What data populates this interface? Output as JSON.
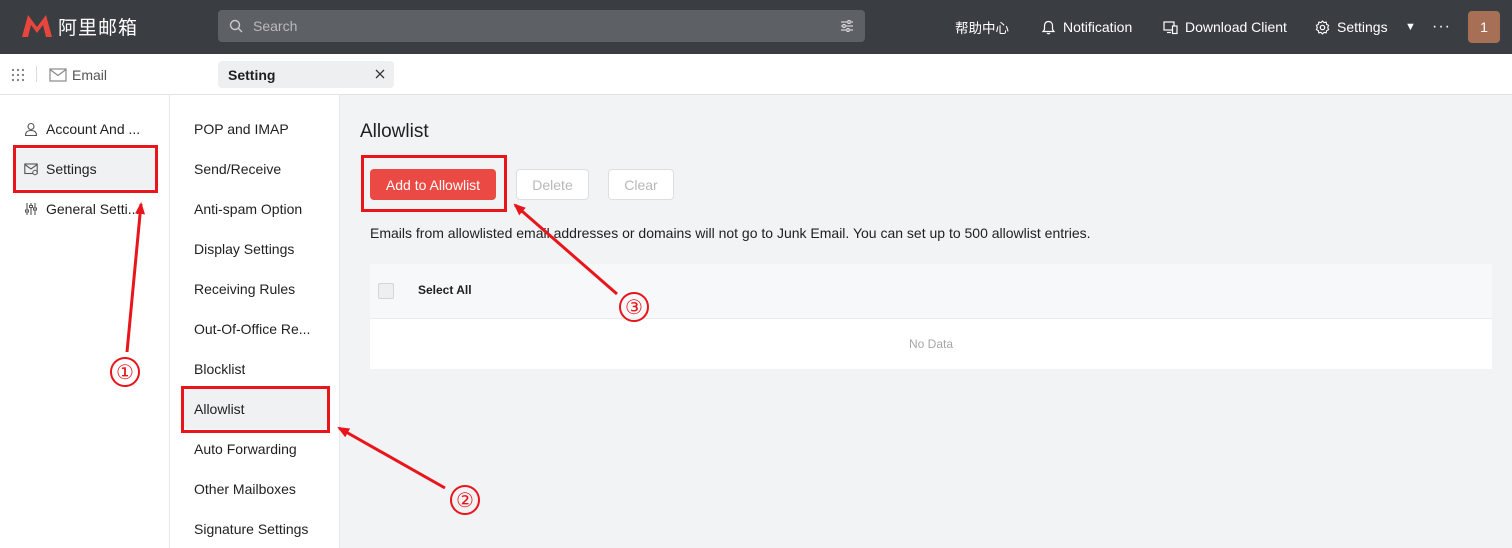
{
  "app": {
    "logo_text": "阿里邮箱",
    "search_placeholder": "Search",
    "nav": {
      "help": "帮助中心",
      "notification": "Notification",
      "download_client": "Download Client",
      "settings": "Settings",
      "more": "···"
    },
    "avatar_initial": "1"
  },
  "tabs": {
    "email_label": "Email",
    "setting_label": "Setting"
  },
  "left_menu": {
    "items": [
      {
        "label": "Account And ...",
        "icon": "user-icon"
      },
      {
        "label": "Settings",
        "icon": "mail-settings-icon",
        "active": true
      },
      {
        "label": "General Setti...",
        "icon": "sliders-icon"
      }
    ]
  },
  "settings_menu": {
    "items": [
      {
        "label": "POP and IMAP"
      },
      {
        "label": "Send/Receive"
      },
      {
        "label": "Anti-spam Option"
      },
      {
        "label": "Display Settings"
      },
      {
        "label": "Receiving Rules"
      },
      {
        "label": "Out-Of-Office Re..."
      },
      {
        "label": "Blocklist"
      },
      {
        "label": "Allowlist",
        "active": true
      },
      {
        "label": "Auto Forwarding"
      },
      {
        "label": "Other Mailboxes"
      },
      {
        "label": "Signature Settings"
      }
    ]
  },
  "content": {
    "title": "Allowlist",
    "buttons": {
      "add": "Add to Allowlist",
      "delete": "Delete",
      "clear": "Clear"
    },
    "notice": "Emails from allowlisted email addresses or domains will not go to Junk Email. You can set up to 500 allowlist entries.",
    "table": {
      "select_all": "Select All",
      "empty_text": "No Data"
    }
  },
  "annotations": {
    "labels": [
      "①",
      "②",
      "③"
    ],
    "color": "#e8151b"
  },
  "colors": {
    "header_bg": "#3a3d41",
    "primary": "#ea4a43",
    "logo_red": "#e8453c"
  }
}
